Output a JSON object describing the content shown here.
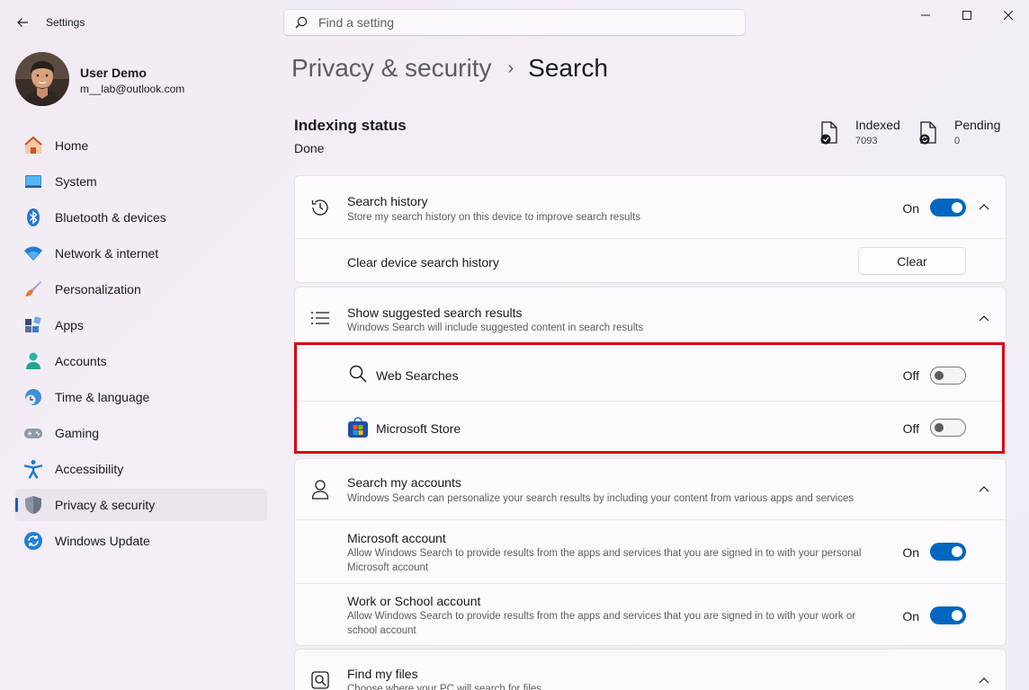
{
  "app": {
    "title": "Settings"
  },
  "search": {
    "placeholder": "Find a setting"
  },
  "user": {
    "name": "User Demo",
    "email": "m__lab@outlook.com"
  },
  "nav": {
    "items": [
      {
        "label": "Home",
        "icon": "home-icon"
      },
      {
        "label": "System",
        "icon": "system-icon"
      },
      {
        "label": "Bluetooth & devices",
        "icon": "bluetooth-icon"
      },
      {
        "label": "Network & internet",
        "icon": "wifi-icon"
      },
      {
        "label": "Personalization",
        "icon": "brush-icon"
      },
      {
        "label": "Apps",
        "icon": "apps-icon"
      },
      {
        "label": "Accounts",
        "icon": "accounts-icon"
      },
      {
        "label": "Time & language",
        "icon": "clock-globe-icon"
      },
      {
        "label": "Gaming",
        "icon": "gamepad-icon"
      },
      {
        "label": "Accessibility",
        "icon": "accessibility-icon"
      },
      {
        "label": "Privacy & security",
        "icon": "shield-icon",
        "active": true
      },
      {
        "label": "Windows Update",
        "icon": "update-icon"
      }
    ]
  },
  "breadcrumb": {
    "parent": "Privacy & security",
    "separator": "›",
    "current": "Search"
  },
  "indexing": {
    "title": "Indexing status",
    "value": "Done",
    "indexed_label": "Indexed",
    "indexed_count": "7093",
    "pending_label": "Pending",
    "pending_count": "0"
  },
  "history": {
    "title": "Search history",
    "desc": "Store my search history on this device to improve search results",
    "state": "On",
    "clear_label": "Clear device search history",
    "clear_button": "Clear"
  },
  "suggested": {
    "title": "Show suggested search results",
    "desc": "Windows Search will include suggested content in search results",
    "web_label": "Web Searches",
    "web_state": "Off",
    "store_label": "Microsoft Store",
    "store_state": "Off"
  },
  "accounts": {
    "title": "Search my accounts",
    "desc": "Windows Search can personalize your search results by including your content from various apps and services",
    "ms_title": "Microsoft account",
    "ms_desc": "Allow Windows Search to provide results from the apps and services that you are signed in to with your personal Microsoft account",
    "ms_state": "On",
    "work_title": "Work or School account",
    "work_desc": "Allow Windows Search to provide results from the apps and services that you are signed in to with your work or school account",
    "work_state": "On"
  },
  "files": {
    "title": "Find my files",
    "desc": "Choose where your PC will search for files"
  },
  "colors": {
    "accent": "#0067c0",
    "highlight": "#d9000f"
  }
}
